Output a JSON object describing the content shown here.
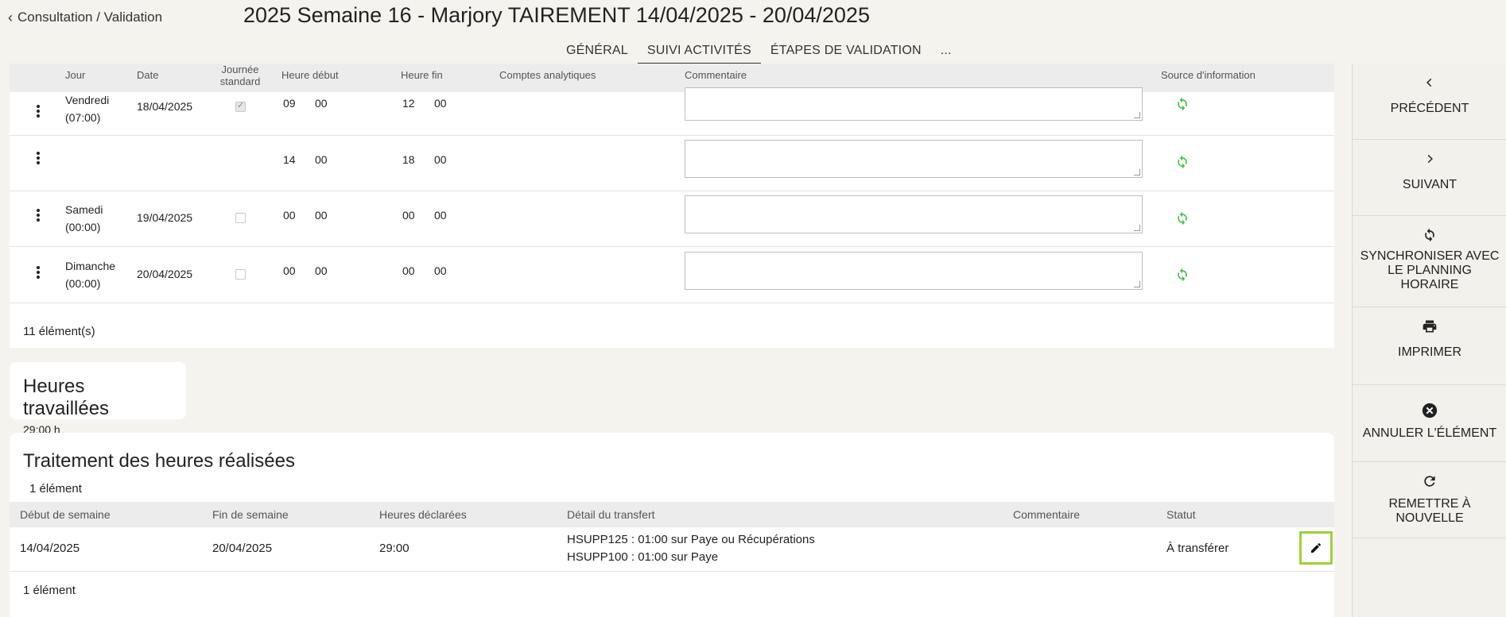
{
  "header": {
    "back_label": "Consultation / Validation",
    "title": "2025 Semaine 16 - Marjory TAIREMENT 14/04/2025 - 20/04/2025"
  },
  "tabs": [
    {
      "label": "GÉNÉRAL"
    },
    {
      "label": "SUIVI ACTIVITÉS"
    },
    {
      "label": "ÉTAPES DE VALIDATION"
    },
    {
      "label": "..."
    }
  ],
  "activities": {
    "columns": {
      "jour": "Jour",
      "date": "Date",
      "journee_standard": "Journée standard",
      "heure_debut": "Heure début",
      "heure_fin": "Heure fin",
      "comptes": "Comptes analytiques",
      "commentaire": "Commentaire",
      "source": "Source d'information"
    },
    "rows": [
      {
        "jour": "Vendredi",
        "duree": "(07:00)",
        "date": "18/04/2025",
        "standard": true,
        "debut_h": "09",
        "debut_m": "00",
        "fin_h": "12",
        "fin_m": "00"
      },
      {
        "jour": "",
        "duree": "",
        "date": "",
        "standard": null,
        "debut_h": "14",
        "debut_m": "00",
        "fin_h": "18",
        "fin_m": "00"
      },
      {
        "jour": "Samedi",
        "duree": "(00:00)",
        "date": "19/04/2025",
        "standard": false,
        "debut_h": "00",
        "debut_m": "00",
        "fin_h": "00",
        "fin_m": "00"
      },
      {
        "jour": "Dimanche",
        "duree": "(00:00)",
        "date": "20/04/2025",
        "standard": false,
        "debut_h": "00",
        "debut_m": "00",
        "fin_h": "00",
        "fin_m": "00"
      }
    ],
    "footer": "11 élément(s)"
  },
  "hours_worked": {
    "title": "Heures travaillées",
    "value": "29:00 h"
  },
  "treatment": {
    "title": "Traitement des heures réalisées",
    "count": "1 élément",
    "columns": {
      "debut": "Début de semaine",
      "fin": "Fin de semaine",
      "heures": "Heures déclarées",
      "detail": "Détail du transfert",
      "commentaire": "Commentaire",
      "statut": "Statut"
    },
    "rows": [
      {
        "debut": "14/04/2025",
        "fin": "20/04/2025",
        "heures": "29:00",
        "detail_1": "HSUPP125 : 01:00 sur Paye ou Récupérations",
        "detail_2": "HSUPP100 : 01:00 sur Paye",
        "commentaire": "",
        "statut": "À transférer"
      }
    ],
    "footer": "1 élément"
  },
  "sidebar": {
    "items": [
      {
        "label": "PRÉCÉDENT",
        "icon": "chevron-left-icon"
      },
      {
        "label": "SUIVANT",
        "icon": "chevron-right-icon"
      },
      {
        "label": "SYNCHRONISER AVEC LE PLANNING HORAIRE",
        "icon": "sync-icon"
      },
      {
        "label": "IMPRIMER",
        "icon": "print-icon"
      },
      {
        "label": "ANNULER L'ÉLÉMENT",
        "icon": "cancel-circle-icon"
      },
      {
        "label": "REMETTRE À NOUVELLE",
        "icon": "refresh-icon"
      }
    ]
  },
  "colors": {
    "accent_green": "#4cc24c",
    "highlight_border": "#9ad33a",
    "background": "#f5f3ee"
  }
}
